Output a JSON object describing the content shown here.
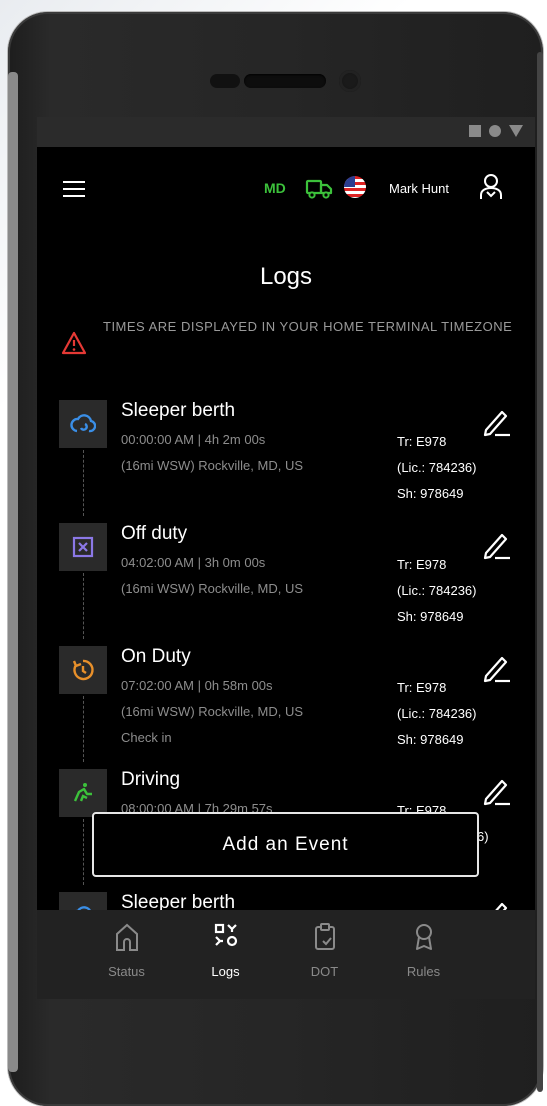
{
  "header": {
    "state": "MD",
    "user_name": "Mark Hunt"
  },
  "page": {
    "title": "Logs",
    "notice": "TIMES ARE DISPLAYED IN YOUR HOME TERMINAL TIMEZONE"
  },
  "events": [
    {
      "title": "Sleeper berth",
      "line1": "00:00:00 AM | 4h 2m 00s",
      "line2": "(16mi WSW) Rockville, MD, US",
      "line3": "",
      "tr": "Tr: E978",
      "lic": "(Lic.: 784236)",
      "sh": "Sh: 978649",
      "icon": "sleeper-berth-icon",
      "color": "#3a8ee6"
    },
    {
      "title": "Off duty",
      "line1": "04:02:00 AM | 3h 0m 00s",
      "line2": "(16mi WSW) Rockville, MD, US",
      "line3": "",
      "tr": "Tr: E978",
      "lic": "(Lic.: 784236)",
      "sh": "Sh: 978649",
      "icon": "off-duty-icon",
      "color": "#8b78e6"
    },
    {
      "title": "On Duty",
      "line1": "07:02:00 AM | 0h 58m 00s",
      "line2": "(16mi WSW) Rockville, MD, US",
      "line3": "Check in",
      "tr": "Tr: E978",
      "lic": "(Lic.: 784236)",
      "sh": "Sh: 978649",
      "icon": "on-duty-icon",
      "color": "#e8902a"
    },
    {
      "title": "Driving",
      "line1": "08:00:00 AM | 7h 29m 57s",
      "line2": "",
      "line3": "",
      "tr": "Tr: E978",
      "lic": "6)",
      "sh": "",
      "icon": "driving-icon",
      "color": "#3cc13b"
    },
    {
      "title": "Sleeper berth",
      "line1": "",
      "line2": "",
      "line3": "",
      "tr": "",
      "lic": "",
      "sh": "",
      "icon": "sleeper-berth-icon",
      "color": "#3a8ee6"
    }
  ],
  "add_button": "Add an Event",
  "nav": [
    {
      "label": "Status",
      "icon": "home-icon"
    },
    {
      "label": "Logs",
      "icon": "logs-icon"
    },
    {
      "label": "DOT",
      "icon": "clipboard-icon"
    },
    {
      "label": "Rules",
      "icon": "award-icon"
    }
  ],
  "colors": {
    "accent_green": "#3cc13b",
    "warning_red": "#e53935"
  }
}
